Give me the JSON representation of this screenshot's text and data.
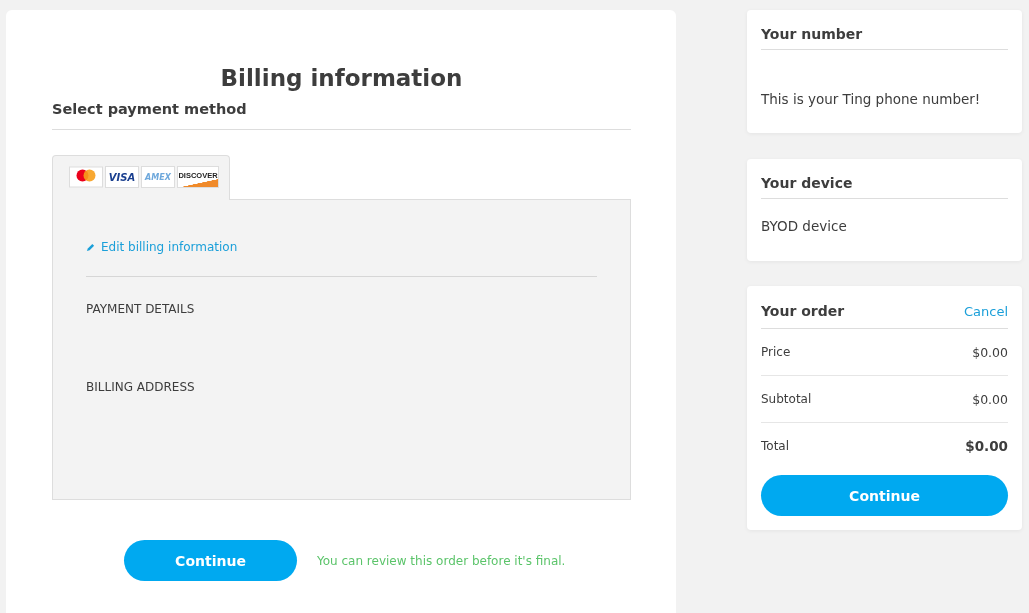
{
  "billing": {
    "title": "Billing information",
    "section_title": "Select payment method",
    "cards": [
      {
        "kind": "mastercard"
      },
      {
        "kind": "visa",
        "label": "VISA"
      },
      {
        "kind": "amex",
        "label": "AMEX"
      },
      {
        "kind": "discover",
        "label": "DISCOVER"
      }
    ],
    "edit_link": "Edit billing information",
    "payment_details": "PAYMENT DETAILS",
    "billing_address": "BILLING ADDRESS",
    "continue": "Continue",
    "note": "You can review this order before it's final."
  },
  "number_card": {
    "title": "Your number",
    "text": "This is your Ting phone number!"
  },
  "device_card": {
    "title": "Your device",
    "text": "BYOD device"
  },
  "order_card": {
    "title": "Your order",
    "cancel": "Cancel",
    "rows": [
      {
        "label": "Price",
        "value": "$0.00",
        "emphasized": false
      },
      {
        "label": "Subtotal",
        "value": "$0.00",
        "emphasized": false
      },
      {
        "label": "Total",
        "value": "$0.00",
        "emphasized": true
      }
    ],
    "continue": "Continue"
  }
}
